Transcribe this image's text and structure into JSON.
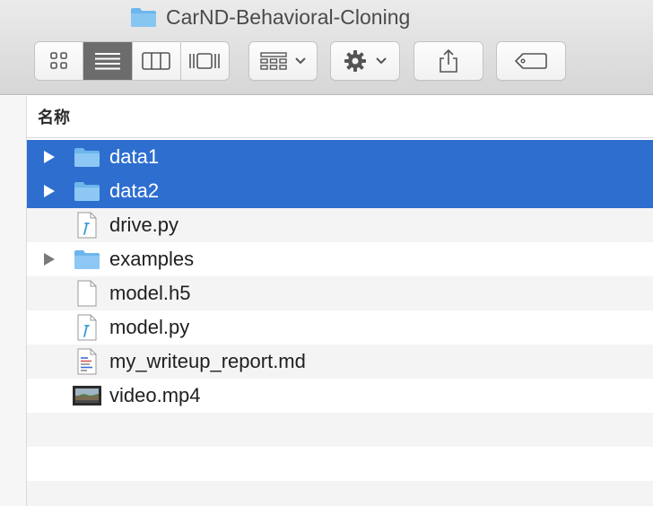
{
  "window": {
    "title": "CarND-Behavioral-Cloning"
  },
  "toolbar": {
    "view_modes": [
      "icon-view",
      "list-view",
      "column-view",
      "gallery-view"
    ],
    "active_view": "list-view",
    "arrange_icon": "grid-arrange-icon",
    "action_icon": "gear-icon",
    "share_icon": "share-icon",
    "tag_icon": "tag-icon"
  },
  "list": {
    "column_header": "名称",
    "items": [
      {
        "name": "data1",
        "kind": "folder",
        "expandable": true,
        "selected": true
      },
      {
        "name": "data2",
        "kind": "folder",
        "expandable": true,
        "selected": true
      },
      {
        "name": "drive.py",
        "kind": "python",
        "expandable": false,
        "selected": false
      },
      {
        "name": "examples",
        "kind": "folder",
        "expandable": true,
        "selected": false
      },
      {
        "name": "model.h5",
        "kind": "blank",
        "expandable": false,
        "selected": false
      },
      {
        "name": "model.py",
        "kind": "python",
        "expandable": false,
        "selected": false
      },
      {
        "name": "my_writeup_report.md",
        "kind": "markdown",
        "expandable": false,
        "selected": false
      },
      {
        "name": "video.mp4",
        "kind": "video",
        "expandable": false,
        "selected": false
      }
    ]
  },
  "colors": {
    "selection": "#2e6ecf",
    "folder": "#6cb6ec",
    "alt_row": "#f4f4f4"
  }
}
